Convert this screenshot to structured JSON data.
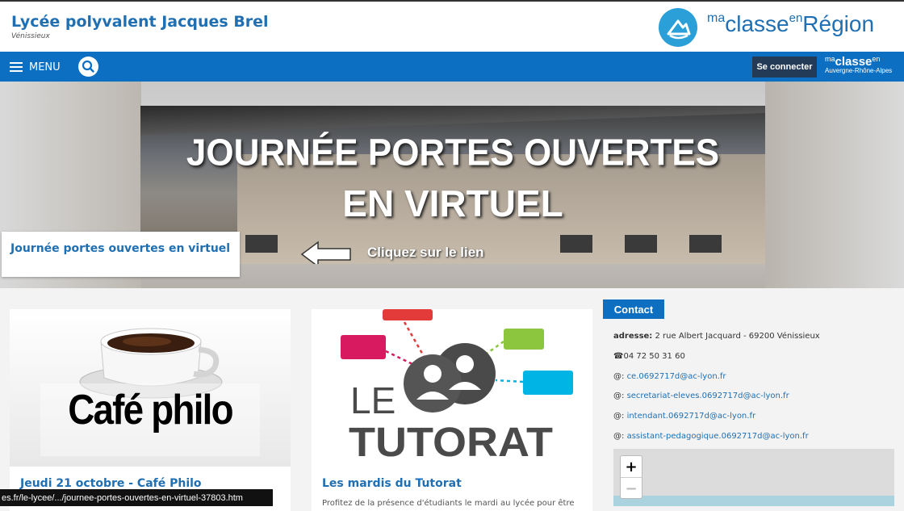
{
  "site": {
    "title": "Lycée polyvalent Jacques Brel",
    "subtitle": "Vénissieux"
  },
  "brand": {
    "ma": "ma",
    "classe": "classe",
    "en": "en",
    "region": "Région"
  },
  "nav": {
    "menu_label": "MENU",
    "login_label": "Se connecter",
    "brand_ma": "ma",
    "brand_classe": "classe",
    "brand_en": "en",
    "brand_region": "Auvergne-Rhône-Alpes"
  },
  "hero": {
    "banner_line1": "JOURNÉE PORTES OUVERTES",
    "banner_line2": "EN VIRTUEL",
    "banner_cta": "Cliquez sur le lien",
    "caption": "Journée portes ouvertes en virtuel"
  },
  "cards": [
    {
      "image_text": "Café philo",
      "title": "Jeudi 21 octobre - Café Philo",
      "text": ""
    },
    {
      "image_text_1": "LE",
      "image_text_2": "TUTORAT",
      "title": "Les mardis du Tutorat",
      "text": "Profitez de la présence d'étudiants le mardi au lycée pour être"
    }
  ],
  "contact": {
    "heading": "Contact",
    "address_label": "adresse:",
    "address_value": "2 rue Albert Jacquard - 69200 Vénissieux",
    "phone": "04 72 50 31 60",
    "email_prefix": "@:",
    "emails": [
      "ce.0692717d@ac-lyon.fr",
      "secretariat-eleves.0692717d@ac-lyon.fr",
      "intendant.0692717d@ac-lyon.fr",
      "assistant-pedagogique.0692717d@ac-lyon.fr"
    ]
  },
  "map": {
    "zoom_in": "+",
    "zoom_out": "−"
  },
  "status_bar": {
    "url": "es.fr/le-lycee/.../journee-portes-ouvertes-en-virtuel-37803.htm"
  },
  "colors": {
    "primary": "#0d6fc2",
    "title_blue": "#1f6fb2",
    "login_bg": "#233b56"
  }
}
